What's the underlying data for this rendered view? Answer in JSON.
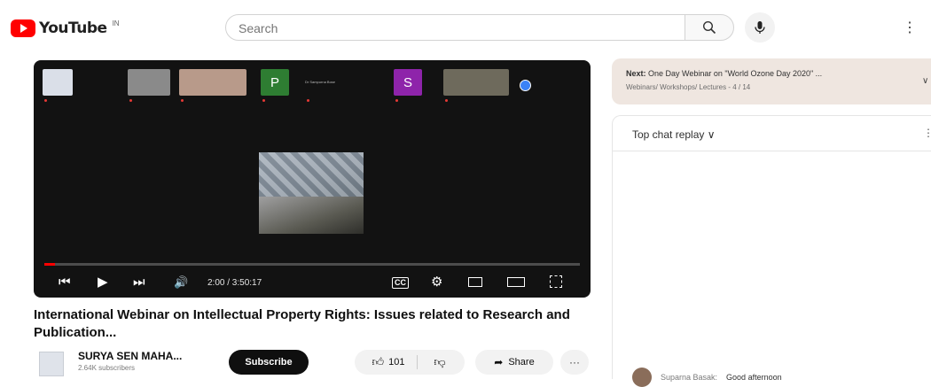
{
  "header": {
    "logo_text": "YouTube",
    "region": "IN",
    "search_placeholder": "Search"
  },
  "player": {
    "participants": [
      {
        "name": "",
        "avatar": "logo",
        "color": "#dadfe8"
      },
      {
        "name": "",
        "avatar": "emblem",
        "color": "#8a8a8a"
      },
      {
        "name": "",
        "avatar": "video",
        "color": "#b89a8a"
      },
      {
        "name": "",
        "avatar": "P",
        "color": "#2e7d32"
      },
      {
        "name": "Dr Sampurna Bose",
        "avatar": "",
        "color": "#121212"
      },
      {
        "name": "",
        "avatar": "S",
        "color": "#8e24aa"
      },
      {
        "name": "",
        "avatar": "video",
        "color": "#6e6a5c"
      }
    ],
    "time_display": "2:00 / 3:50:17",
    "progress_fraction": 0.02
  },
  "video": {
    "title": "International Webinar on Intellectual Property Rights: Issues related to Research and Publication..."
  },
  "channel": {
    "name": "SURYA SEN MAHA...",
    "subscribers": "2.64K subscribers",
    "subscribe_label": "Subscribe"
  },
  "actions": {
    "like_count": "101",
    "share_label": "Share",
    "more": "···"
  },
  "sidebar": {
    "next_label": "Next:",
    "next_title": "One Day Webinar on \"World Ozone Day 2020\" ...",
    "playlist": "Webinars/ Workshops/ Lectures - 4 / 14",
    "chat_title": "Top chat replay ∨",
    "chat_message": {
      "author": "Suparna Basak:",
      "text": "Good afternoon"
    }
  },
  "colors": {
    "brand_red": "#ff0000",
    "player_bg": "#121212",
    "next_bg": "#efe6e0"
  }
}
